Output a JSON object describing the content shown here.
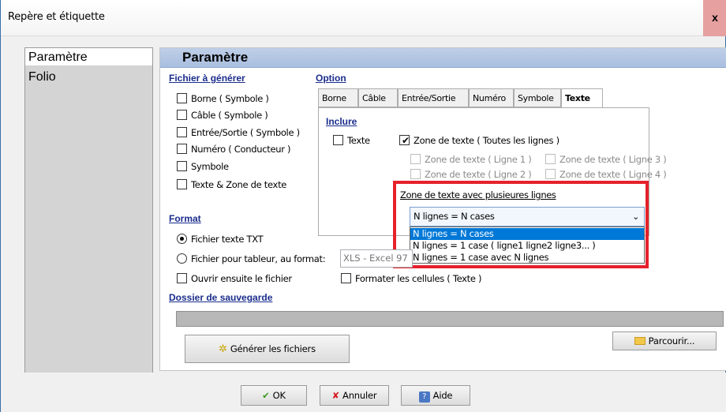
{
  "window": {
    "title": "Repère et étiquette",
    "close_label": "x"
  },
  "nav": {
    "items": [
      "Paramètre",
      "Folio"
    ],
    "selected": "Paramètre"
  },
  "header": {
    "title": "Paramètre"
  },
  "fichier": {
    "section_label": "Fichier à générer",
    "options": [
      {
        "label": "Borne ( Symbole )",
        "checked": false
      },
      {
        "label": "Câble ( Symbole )",
        "checked": false
      },
      {
        "label": "Entrée/Sortie ( Symbole )",
        "checked": false
      },
      {
        "label": "Numéro ( Conducteur )",
        "checked": false
      },
      {
        "label": "Symbole",
        "checked": false
      },
      {
        "label": "Texte & Zone de texte",
        "checked": false
      }
    ]
  },
  "option": {
    "section_label": "Option",
    "tabs": [
      "Borne",
      "Câble",
      "Entrée/Sortie",
      "Numéro",
      "Symbole",
      "Texte"
    ],
    "active_tab": "Texte",
    "inclure_label": "Inclure",
    "texte_label": "Texte",
    "zone_toutes_label": "Zone de texte ( Toutes les lignes )",
    "zone_l1": "Zone de texte ( Ligne 1 )",
    "zone_l3": "Zone de texte ( Ligne 3 )",
    "zone_l2": "Zone de texte ( Ligne 2 )",
    "zone_l4": "Zone de texte ( Ligne 4 )",
    "multiline_label": "Zone de texte avec plusieures lignes",
    "multiline_value": "N lignes = N cases",
    "multiline_options": [
      "N lignes = N cases",
      "N lignes = 1 case ( ligne1 ligne2 ligne3... )",
      "N lignes = 1 case avec N lignes"
    ]
  },
  "format": {
    "section_label": "Format",
    "txt_label": "Fichier texte TXT",
    "tableur_label": "Fichier pour tableur, au format:",
    "xls_value": "XLS - Excel 97",
    "ouvrir_label": "Ouvrir ensuite le fichier",
    "formater_label": "Formater les cellules ( Texte )"
  },
  "dossier": {
    "section_label": "Dossier de sauvegarde",
    "path_value": ""
  },
  "buttons": {
    "generer": "Générer les fichiers",
    "parcourir": "Parcourir...",
    "ok": "OK",
    "annuler": "Annuler",
    "aide": "Aide"
  },
  "colors": {
    "highlight": "#e5212b",
    "selection": "#0078d7",
    "section": "#1a2d8c"
  }
}
